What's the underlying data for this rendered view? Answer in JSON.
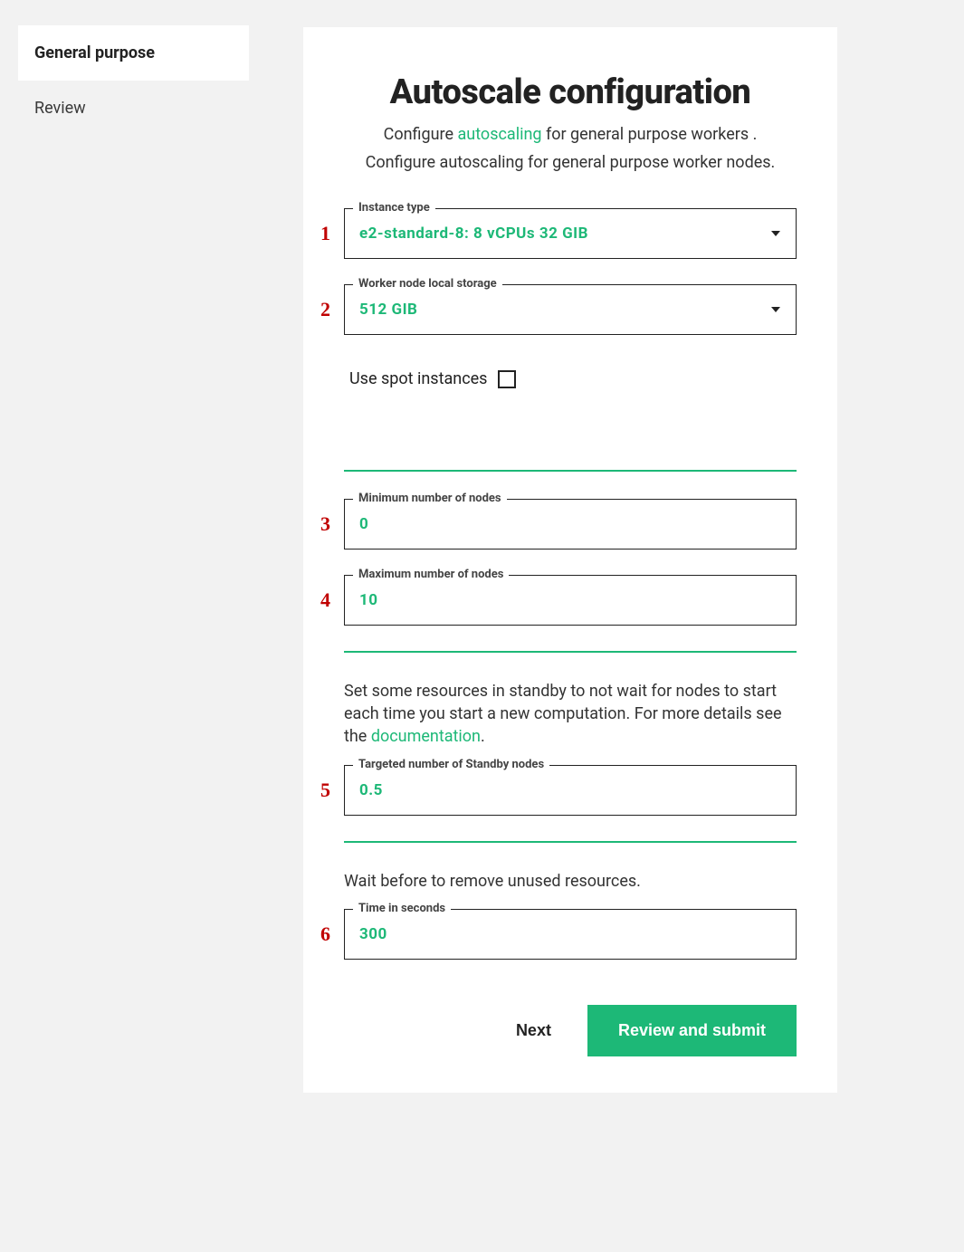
{
  "sidebar": {
    "items": [
      {
        "label": "General purpose",
        "active": true
      },
      {
        "label": "Review",
        "active": false
      }
    ]
  },
  "main": {
    "title": "Autoscale configuration",
    "subtitle1_pre": "Configure ",
    "subtitle1_link": "autoscaling",
    "subtitle1_post": " for general purpose workers .",
    "subtitle2": "Configure autoscaling for general purpose worker nodes.",
    "standby_desc_pre": "Set some resources in standby to not wait for nodes to start each time you start a new computation. For more details see the ",
    "standby_desc_link": "documentation",
    "standby_desc_post": ".",
    "wait_desc": "Wait before to remove unused resources.",
    "btn_next": "Next",
    "btn_submit": "Review and submit"
  },
  "fields": {
    "instance_type": {
      "label": "Instance type",
      "value": "e2-standard-8: 8 vCPUs 32 GIB"
    },
    "local_storage": {
      "label": "Worker node local storage",
      "value": "512 GIB"
    },
    "use_spot": {
      "label": "Use spot instances",
      "checked": false
    },
    "min_nodes": {
      "label": "Minimum number of nodes",
      "value": "0"
    },
    "max_nodes": {
      "label": "Maximum number of nodes",
      "value": "10"
    },
    "standby_nodes": {
      "label": "Targeted number of Standby nodes",
      "value": "0.5"
    },
    "time_seconds": {
      "label": "Time in seconds",
      "value": "300"
    }
  },
  "annotations": {
    "a1": "1",
    "a2": "2",
    "a3": "3",
    "a4": "4",
    "a5": "5",
    "a6": "6"
  }
}
